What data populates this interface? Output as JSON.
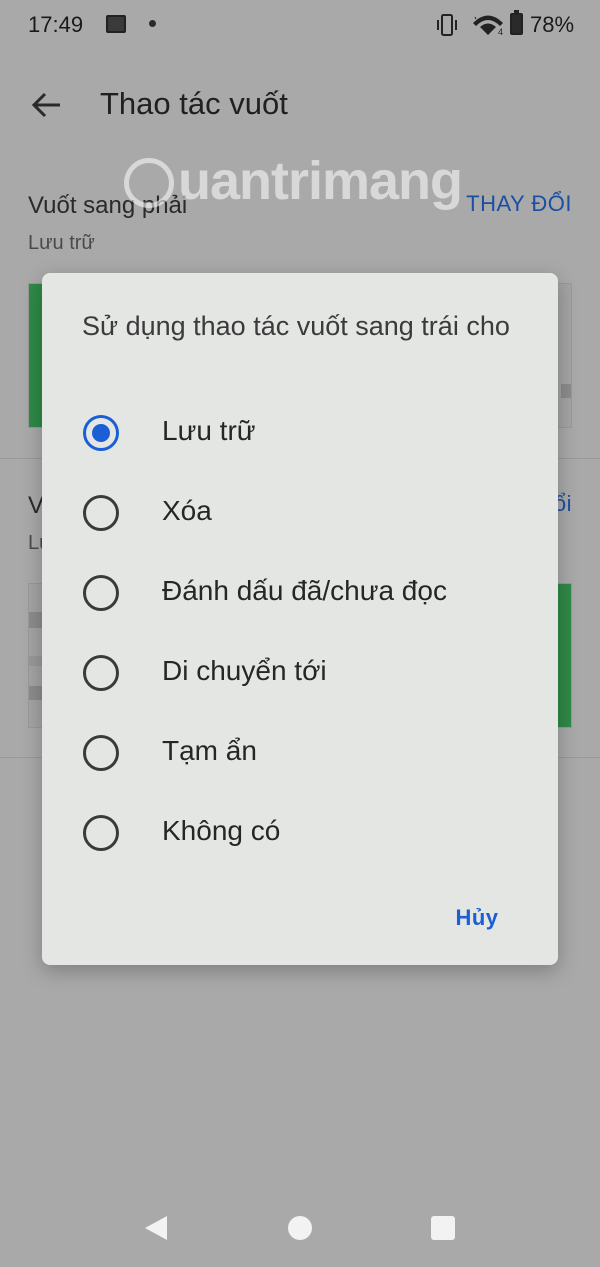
{
  "status_bar": {
    "time": "17:49",
    "battery": "78%",
    "icons": [
      "image-icon",
      "dot-icon",
      "vibrate-icon",
      "wifi-icon",
      "battery-icon"
    ]
  },
  "app_bar": {
    "title": "Thao tác vuốt",
    "back_icon": "back-arrow-icon"
  },
  "settings": {
    "swipe_right": {
      "title": "Vuốt sang phải",
      "value": "Lưu trữ",
      "change_label": "THAY ĐỔI"
    },
    "swipe_left": {
      "title_partial": "V",
      "value_partial": "Lư",
      "change_label_partial": "ổi"
    }
  },
  "watermark": {
    "text": "uantrimang"
  },
  "dialog": {
    "title": "Sử dụng thao tác vuốt sang trái cho",
    "options": [
      {
        "label": "Lưu trữ",
        "checked": true
      },
      {
        "label": "Xóa",
        "checked": false
      },
      {
        "label": "Đánh dấu đã/chưa đọc",
        "checked": false
      },
      {
        "label": "Di chuyển tới",
        "checked": false
      },
      {
        "label": "Tạm ẩn",
        "checked": false
      },
      {
        "label": "Không có",
        "checked": false
      }
    ],
    "cancel_label": "Hủy"
  },
  "colors": {
    "accent": "#1a5fd6",
    "dialog_bg": "#e4e6e4",
    "scrim_bg": "#a9a9a9",
    "preview_green": "#2f8a47"
  },
  "nav_bar": {
    "icons": [
      "nav-back-icon",
      "nav-home-icon",
      "nav-recents-icon"
    ]
  }
}
